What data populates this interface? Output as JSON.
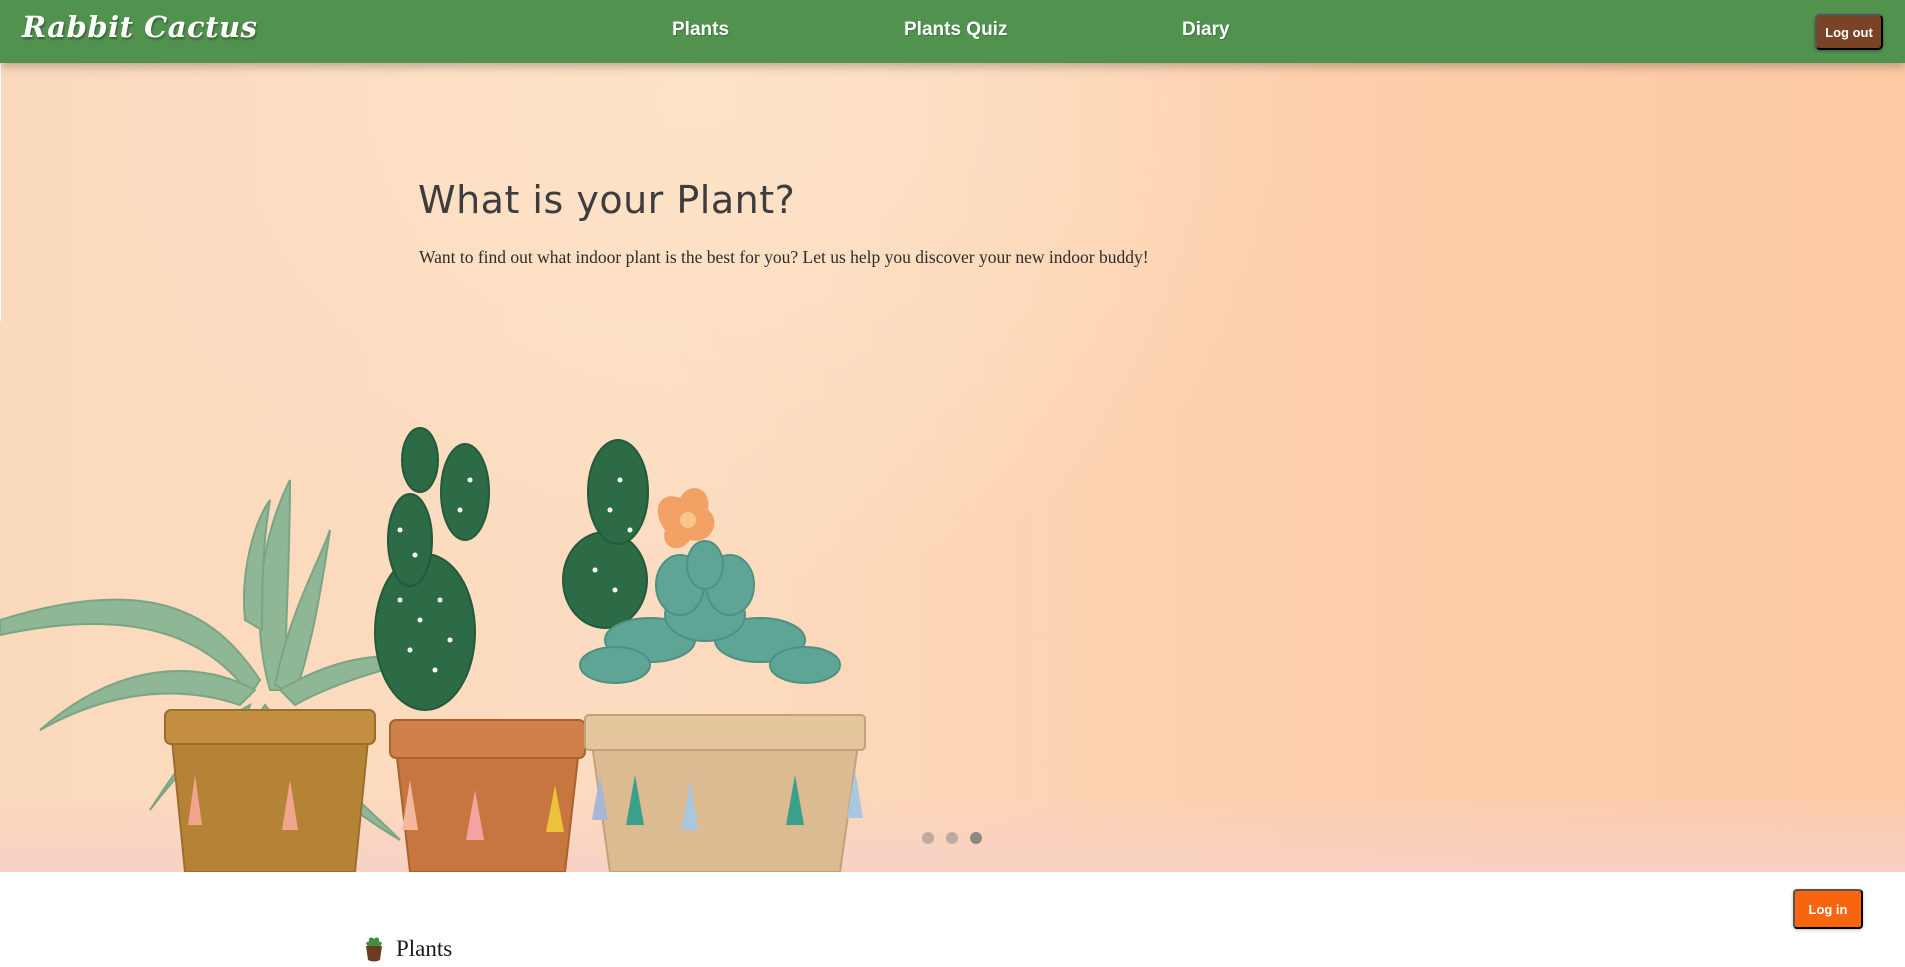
{
  "navbar": {
    "brand": "Rabbit Cactus",
    "links": [
      {
        "label": "Plants"
      },
      {
        "label": "Plants Quiz"
      },
      {
        "label": "Diary"
      }
    ],
    "logout_label": "Log out",
    "color": "#52924f"
  },
  "hero": {
    "title": "What is your Plant?",
    "subtitle": "Want to find out what indoor plant is the best for you? Let us help you discover your new indoor buddy!",
    "carousel": {
      "slide_count": 3,
      "active_index": 2
    }
  },
  "login_label": "Log in",
  "section": {
    "label": "Plants",
    "icon": "potted-plant-icon"
  },
  "colors": {
    "logout_button": "#7a4226",
    "login_button": "#f7650f"
  }
}
